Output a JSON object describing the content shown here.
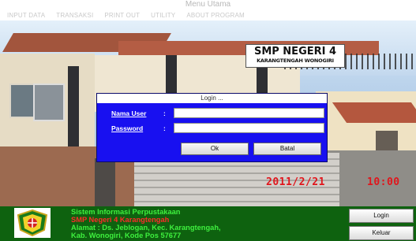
{
  "window": {
    "title": "Menu Utama"
  },
  "menu": [
    "INPUT DATA",
    "TRANSAKSI",
    "PRINT OUT",
    "UTILITY",
    "ABOUT PROGRAM"
  ],
  "sign": {
    "line1": "SMP NEGERI 4",
    "line2": "KARANGTENGAH WONOGIRI"
  },
  "datetime": {
    "date": "2011/2/21",
    "time": "10:00"
  },
  "login": {
    "title": "Login ...",
    "user_label": "Nama User",
    "user_value": "",
    "password_label": "Password",
    "password_value": "",
    "ok_label": "Ok",
    "cancel_label": "Batal",
    "label_color": "#ffffff",
    "background": "#1810f0"
  },
  "footer": {
    "line1": "Sistem Informasi Perpustakaan",
    "line2": "SMP Negeri 4 Karangtengah",
    "line3": "Alamat : Ds. Jeblogan, Kec. Karangtengah,",
    "line4": "Kab. Wonogiri, Kode Pos 57677",
    "login_button": "Login",
    "exit_button": "Keluar",
    "green_text_color": "#3ef03e",
    "red_text_color": "#ff2a2a",
    "panel_color": "#0e620f",
    "logo_icon": "school-emblem-icon"
  }
}
